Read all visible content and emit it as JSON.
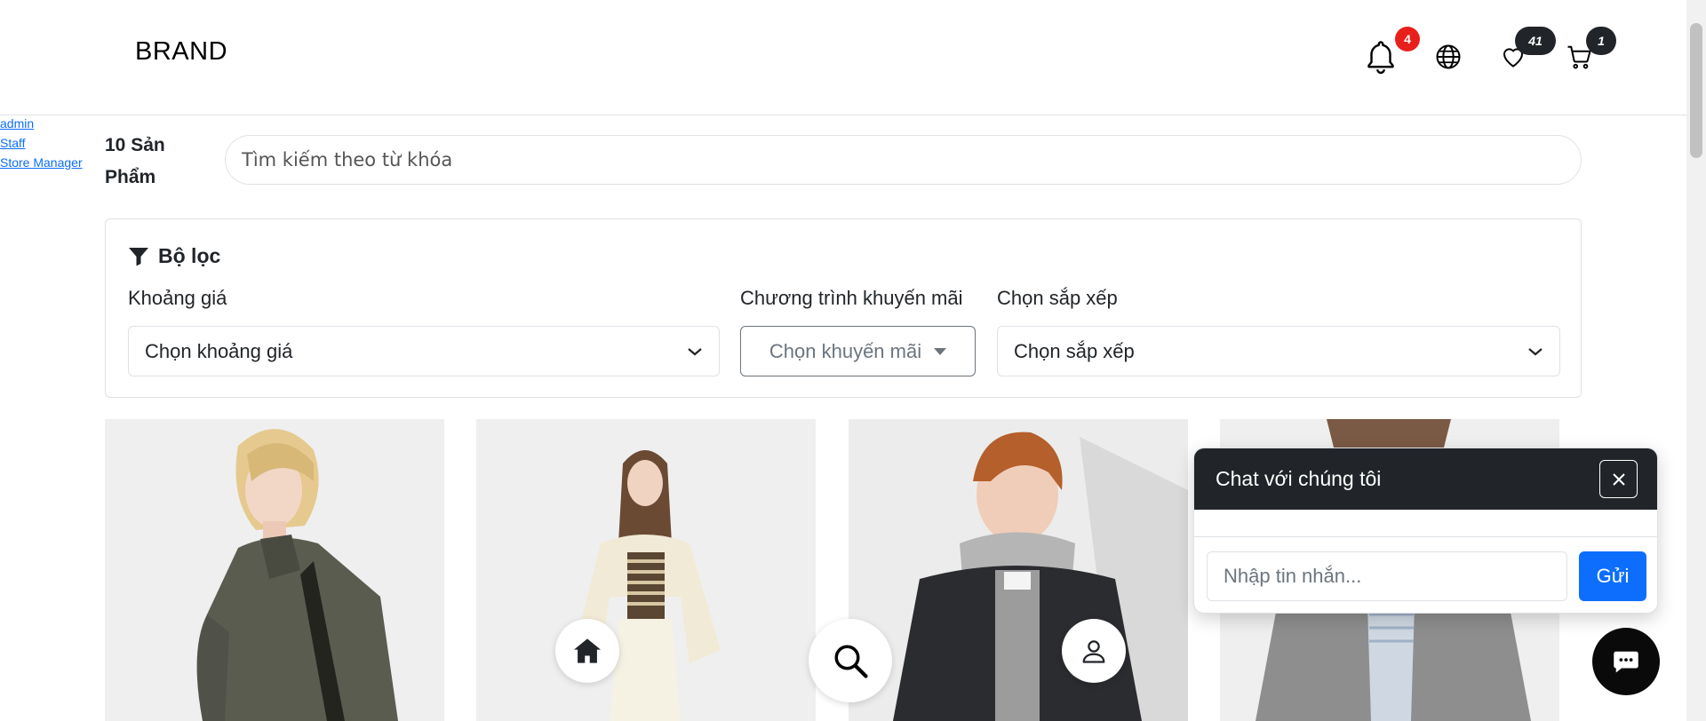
{
  "header": {
    "brand": "BRAND",
    "notification_count": "4",
    "wishlist_count": "41",
    "cart_count": "1"
  },
  "roles": [
    "admin",
    "Staff",
    "Store Manager"
  ],
  "listing": {
    "count_label": "10 Sản Phẩm",
    "search_placeholder": "Tìm kiếm theo từ khóa"
  },
  "filter": {
    "title": "Bộ lọc",
    "price_label": "Khoảng giá",
    "price_value": "Chọn khoảng giá",
    "promo_label": "Chương trình khuyến mãi",
    "promo_value": "Chọn khuyến mãi",
    "sort_label": "Chọn sắp xếp",
    "sort_value": "Chọn sắp xếp"
  },
  "chat": {
    "title": "Chat với chúng tôi",
    "input_placeholder": "Nhập tin nhắn...",
    "send_label": "Gửi"
  },
  "colors": {
    "accent": "#0d6efd",
    "dark": "#212529",
    "badge_red": "#e8201b"
  }
}
